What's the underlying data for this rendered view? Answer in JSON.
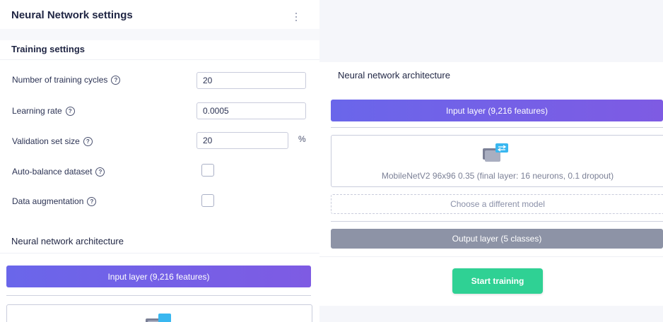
{
  "page": {
    "title": "Neural Network settings"
  },
  "training": {
    "heading": "Training settings",
    "fields": {
      "cycles": {
        "label": "Number of training cycles",
        "help": "?",
        "value": "20"
      },
      "learning_rate": {
        "label": "Learning rate",
        "help": "?",
        "value": "0.0005"
      },
      "validation": {
        "label": "Validation set size",
        "help": "?",
        "value": "20",
        "unit": "%"
      },
      "auto_balance": {
        "label": "Auto-balance dataset",
        "help": "?",
        "checked": false
      },
      "augmentation": {
        "label": "Data augmentation",
        "help": "?",
        "checked": false
      }
    }
  },
  "architecture": {
    "heading": "Neural network architecture",
    "input_layer": "Input layer (9,216 features)",
    "model": "MobileNetV2 96x96 0.35 (final layer: 16 neurons, 0.1 dropout)",
    "choose_model": "Choose a different model",
    "output_layer": "Output layer (5 classes)",
    "start_training": "Start training"
  },
  "colors": {
    "input_layer": "#6a66ea",
    "output_layer": "#8d93a6",
    "start_button": "#2fd194"
  },
  "icons": {
    "model": "image-transfer-icon",
    "help": "question-circle-icon",
    "menu": "kebab-menu-icon"
  }
}
